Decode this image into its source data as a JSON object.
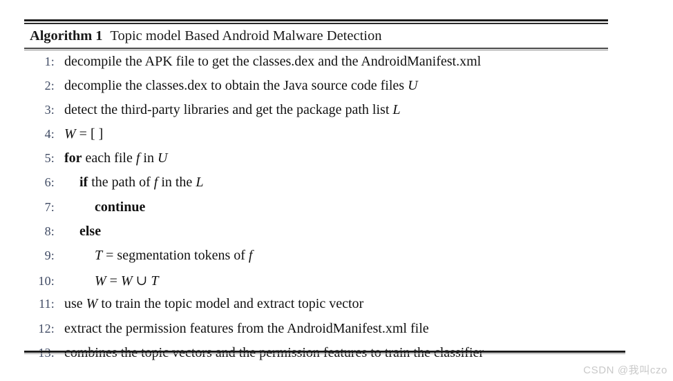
{
  "document": {
    "type": "algorithm-pseudocode-figure",
    "background_color": "#ffffff",
    "rule_color": "#1c1c1c",
    "line_number_color": "#3f4a63",
    "body_text_color": "#111111"
  },
  "algorithm": {
    "label": "Algorithm 1",
    "title": "Topic model Based Android Malware Detection",
    "steps": [
      {
        "number": "1:",
        "indent": 0,
        "text": "decompile the APK file to get the classes.dex and the AndroidManifest.xml",
        "segments": [
          {
            "text": "decompile the APK file to get the classes.dex and the AndroidManifest.xml",
            "style": "normal"
          }
        ]
      },
      {
        "number": "2:",
        "indent": 0,
        "text": "decomplie the classes.dex to obtain the Java source code files U",
        "segments": [
          {
            "text": "decomplie the classes.dex to obtain the Java source code files ",
            "style": "normal"
          },
          {
            "text": "U",
            "style": "italic"
          }
        ]
      },
      {
        "number": "3:",
        "indent": 0,
        "text": "detect the third-party libraries and get the package path list L",
        "segments": [
          {
            "text": "detect the third-party libraries and get the package path list ",
            "style": "normal"
          },
          {
            "text": "L",
            "style": "italic"
          }
        ]
      },
      {
        "number": "4:",
        "indent": 0,
        "text": "W = [ ]",
        "segments": [
          {
            "text": "W",
            "style": "italic"
          },
          {
            "text": " = [ ]",
            "style": "normal"
          }
        ]
      },
      {
        "number": "5:",
        "indent": 0,
        "text": "for each file f in U",
        "segments": [
          {
            "text": "for",
            "style": "bold"
          },
          {
            "text": " each file ",
            "style": "normal"
          },
          {
            "text": "f",
            "style": "italic"
          },
          {
            "text": " in ",
            "style": "normal"
          },
          {
            "text": "U",
            "style": "italic"
          }
        ]
      },
      {
        "number": "6:",
        "indent": 1,
        "text": "if the path of f in the L",
        "segments": [
          {
            "text": "if",
            "style": "bold"
          },
          {
            "text": "  the path of ",
            "style": "normal"
          },
          {
            "text": "f",
            "style": "italic"
          },
          {
            "text": " in the ",
            "style": "normal"
          },
          {
            "text": "L",
            "style": "italic"
          }
        ]
      },
      {
        "number": "7:",
        "indent": 2,
        "text": "continue",
        "segments": [
          {
            "text": "continue",
            "style": "bold"
          }
        ]
      },
      {
        "number": "8:",
        "indent": 1,
        "text": "else",
        "segments": [
          {
            "text": "else",
            "style": "bold"
          }
        ]
      },
      {
        "number": "9:",
        "indent": 2,
        "text": "T = segmentation tokens of f",
        "segments": [
          {
            "text": "T",
            "style": "italic"
          },
          {
            "text": " = segmentation tokens of ",
            "style": "normal"
          },
          {
            "text": "f",
            "style": "italic"
          }
        ]
      },
      {
        "number": "10:",
        "indent": 2,
        "text": "W = W ∪ T",
        "segments": [
          {
            "text": "W",
            "style": "italic"
          },
          {
            "text": " = ",
            "style": "normal"
          },
          {
            "text": "W",
            "style": "italic"
          },
          {
            "text": " ∪ ",
            "style": "normal"
          },
          {
            "text": "T",
            "style": "italic"
          }
        ]
      },
      {
        "number": "11:",
        "indent": 0,
        "text": "use W to train the topic model and extract topic vector",
        "segments": [
          {
            "text": "use ",
            "style": "normal"
          },
          {
            "text": "W",
            "style": "italic"
          },
          {
            "text": " to train the topic model and extract topic vector",
            "style": "normal"
          }
        ]
      },
      {
        "number": "12:",
        "indent": 0,
        "text": "extract the permission features from the AndroidManifest.xml file",
        "segments": [
          {
            "text": "extract the permission features from the AndroidManifest.xml file",
            "style": "normal"
          }
        ]
      },
      {
        "number": "13:",
        "indent": 0,
        "text": "combines the topic vectors and the permission features to train the classifier",
        "segments": [
          {
            "text": "combines the topic vectors and the permission features to train the classifier",
            "style": "normal"
          }
        ]
      }
    ]
  },
  "watermark": {
    "text": "CSDN @我叫czo"
  }
}
